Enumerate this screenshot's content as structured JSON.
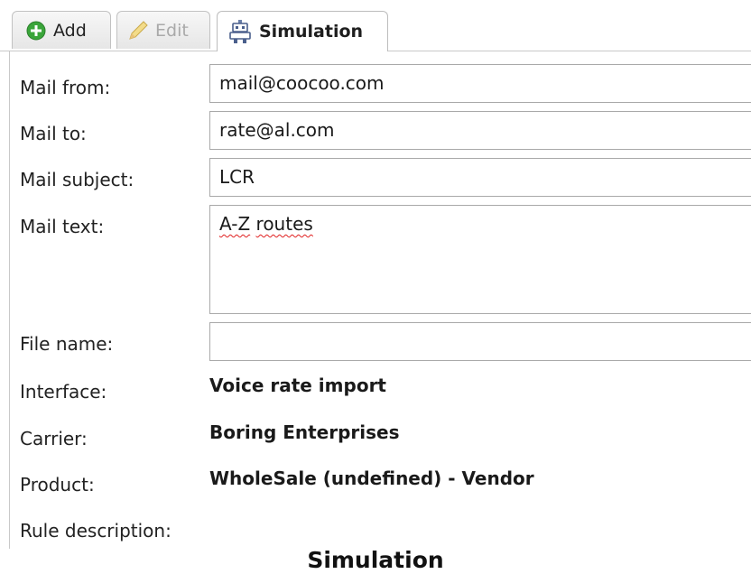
{
  "tabs": {
    "add_label": "Add",
    "edit_label": "Edit",
    "simulation_label": "Simulation"
  },
  "form": {
    "mail_from": {
      "label": "Mail from:",
      "value": "mail@coocoo.com"
    },
    "mail_to": {
      "label": "Mail to:",
      "value": "rate@al.com"
    },
    "mail_subject": {
      "label": "Mail subject:",
      "value": "LCR"
    },
    "mail_text": {
      "label": "Mail text:",
      "value_part1": "A-Z",
      "value_part2": "routes"
    },
    "file_name": {
      "label": "File name:",
      "value": ""
    },
    "interface": {
      "label": "Interface:",
      "value": "Voice rate import"
    },
    "carrier": {
      "label": "Carrier:",
      "value": "Boring Enterprises"
    },
    "product": {
      "label": "Product:",
      "value": "WholeSale (undefined) - Vendor"
    },
    "rule_description": {
      "label": "Rule description:",
      "value": ""
    }
  },
  "caption": "Simulation",
  "icons": {
    "add": "add-circle-icon",
    "edit": "pencil-icon",
    "simulation": "robot-icon"
  },
  "colors": {
    "add_icon_green": "#3aa53a",
    "spellcheck_underline": "#e02020",
    "tab_border": "#c2c2c2"
  }
}
